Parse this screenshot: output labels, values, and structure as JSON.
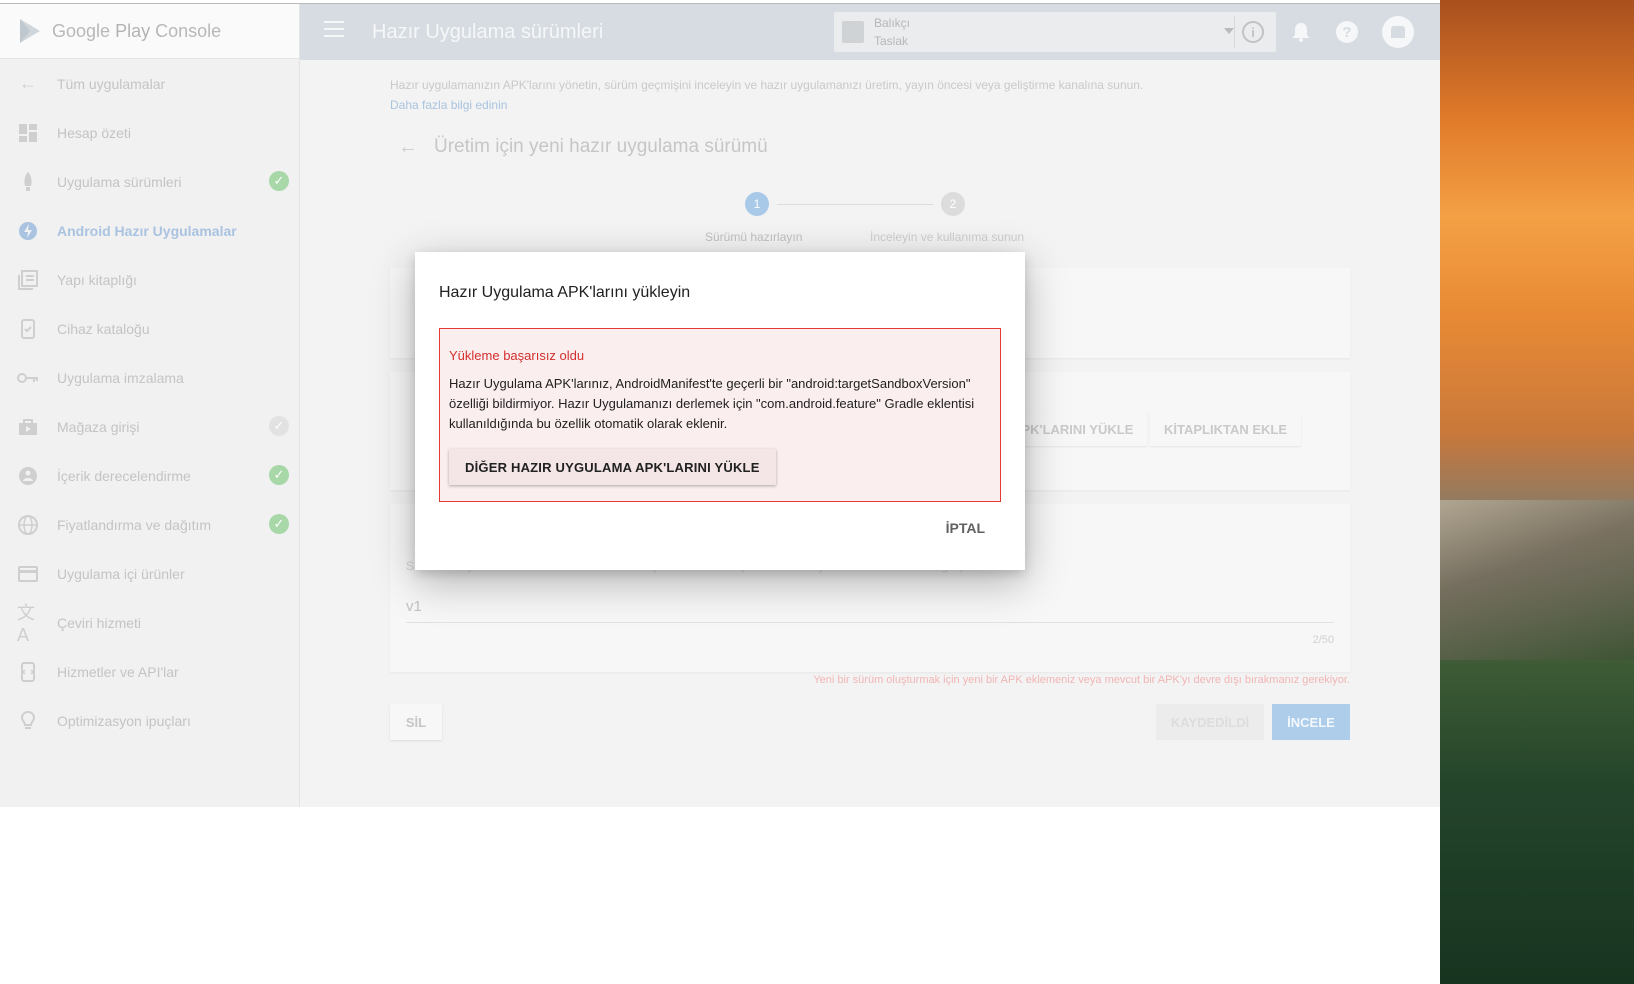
{
  "brand": {
    "google": "Google",
    "play": "Play",
    "console": "Console"
  },
  "sidebar": {
    "items": [
      {
        "label": "Tüm uygulamalar",
        "icon": "arrow-back-icon"
      },
      {
        "label": "Hesap özeti",
        "icon": "dashboard-icon"
      },
      {
        "label": "Uygulama sürümleri",
        "icon": "rocket-icon",
        "checked": true
      },
      {
        "label": "Android Hazır Uygulamalar",
        "icon": "instant-app-icon",
        "active": true
      },
      {
        "label": "Yapı kitaplığı",
        "icon": "library-icon"
      },
      {
        "label": "Cihaz kataloğu",
        "icon": "device-catalog-icon"
      },
      {
        "label": "Uygulama imzalama",
        "icon": "key-icon"
      },
      {
        "label": "Mağaza girişi",
        "icon": "store-icon",
        "checked_faint": true
      },
      {
        "label": "İçerik derecelendirme",
        "icon": "rating-icon",
        "checked": true
      },
      {
        "label": "Fiyatlandırma ve dağıtım",
        "icon": "globe-icon",
        "checked": true
      },
      {
        "label": "Uygulama içi ürünler",
        "icon": "card-icon"
      },
      {
        "label": "Çeviri hizmeti",
        "icon": "translate-icon"
      },
      {
        "label": "Hizmetler ve API'lar",
        "icon": "services-icon"
      },
      {
        "label": "Optimizasyon ipuçları",
        "icon": "lightbulb-icon"
      }
    ]
  },
  "topbar": {
    "title": "Hazır Uygulama sürümleri",
    "app_name": "Balıkçı",
    "app_status": "Taslak"
  },
  "content": {
    "intro": "Hazır uygulamanızın APK'larını yönetin, sürüm geçmişini inceleyin ve hazır uygulamanızı üretim, yayın öncesi veya geliştirme kanalına sunun.",
    "learn_more": "Daha fazla bilgi edinin",
    "heading": "Üretim için yeni hazır uygulama sürümü",
    "steps": [
      {
        "number": "1",
        "label": "Sürümü hazırlayın"
      },
      {
        "number": "2",
        "label": "İnceleyin ve kullanıma sunun"
      }
    ],
    "card2_upload_button": "A APK'LARINI YÜKLE",
    "card2_library_button": "KİTAPLIKTAN EKLE",
    "card3_hint": "Sadece Play Console'da sürümü tanımlamak için kullanılan ad (dahili kod adı ya da derleme sürümü gibi).",
    "release_name_value": "v1",
    "release_name_counter": "2/50",
    "warning": "Yeni bir sürüm oluşturmak için yeni bir APK eklemeniz veya mevcut bir APK'yı devre dışı bırakmanız gerekiyor.",
    "delete_button": "SİL",
    "saved_button": "KAYDEDİLDİ",
    "review_button": "İNCELE"
  },
  "dialog": {
    "title": "Hazır Uygulama APK'larını yükleyin",
    "error_title": "Yükleme başarısız oldu",
    "error_message": "Hazır Uygulama APK'larınız, AndroidManifest'te geçerli bir \"android:targetSandboxVersion\" özelliği bildirmiyor. Hazır Uygulamanızı derlemek için \"com.android.feature\" Gradle eklentisi kullanıldığında bu özellik otomatik olarak eklenir.",
    "upload_other_button": "DİĞER HAZIR UYGULAMA APK'LARINI YÜKLE",
    "cancel_button": "İPTAL"
  },
  "colors": {
    "accent": "#1a73e8",
    "error": "#d32f2f",
    "check": "#4caf50"
  }
}
